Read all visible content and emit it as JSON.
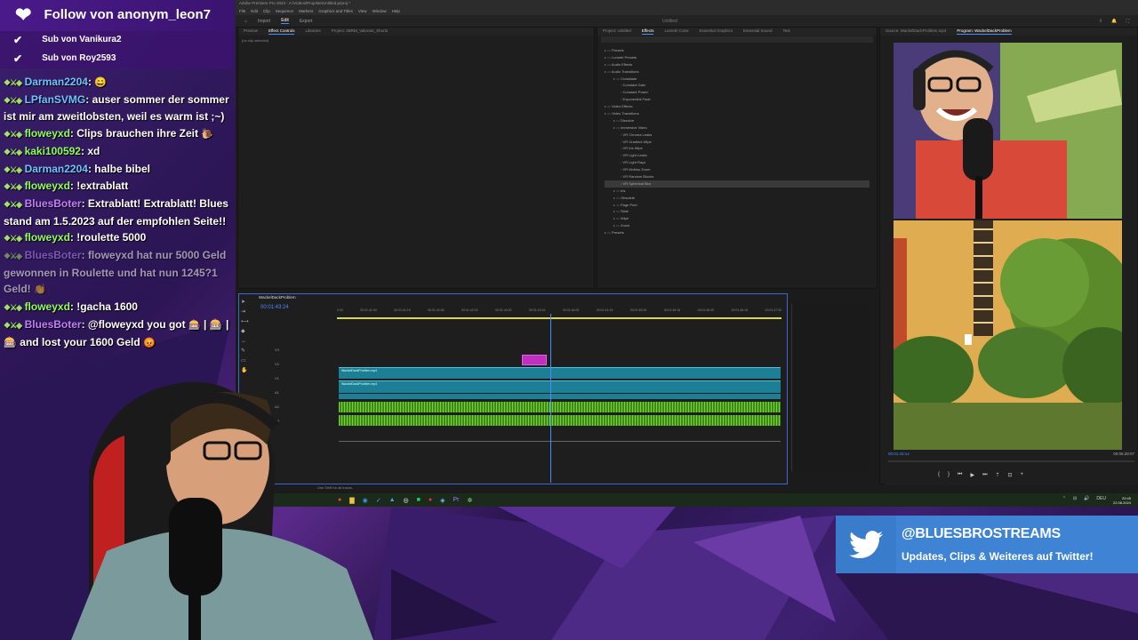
{
  "premiere": {
    "title": "Adobe Premiere Pro 2024 - A:\\Videos\\Projekte\\Untitled.prproj *",
    "menu": [
      "File",
      "Edit",
      "Clip",
      "Sequence",
      "Markers",
      "Graphics and Titles",
      "View",
      "Window",
      "Help"
    ],
    "workspaces": [
      "Import",
      "Edit",
      "Export"
    ],
    "active_workspace": "Edit",
    "project_name": "Untitled",
    "source_tabs": [
      "Preview",
      "Effect Controls",
      "Libraries",
      "Project: 2BRM_Valorant_Shorts"
    ],
    "no_clip": "(no clip selected)",
    "effects_tabs": [
      "Project: Untitled",
      "Effects",
      "Lumetri Color",
      "Essential Graphics",
      "Essential Sound",
      "Text"
    ],
    "effects_items": [
      {
        "label": "Presets",
        "type": "folder",
        "level": 0
      },
      {
        "label": "Lumetri Presets",
        "type": "folder",
        "level": 0
      },
      {
        "label": "Audio Effects",
        "type": "folder",
        "level": 0
      },
      {
        "label": "Audio Transitions",
        "type": "folder",
        "level": 0
      },
      {
        "label": "Crossfade",
        "type": "folder",
        "level": 1
      },
      {
        "label": "Constant Gain",
        "type": "item",
        "level": 2
      },
      {
        "label": "Constant Power",
        "type": "item",
        "level": 2
      },
      {
        "label": "Exponential Fade",
        "type": "item",
        "level": 2
      },
      {
        "label": "Video Effects",
        "type": "folder",
        "level": 0
      },
      {
        "label": "Video Transitions",
        "type": "folder",
        "level": 0
      },
      {
        "label": "Dissolve",
        "type": "folder",
        "level": 1
      },
      {
        "label": "Immersive Video",
        "type": "folder",
        "level": 1
      },
      {
        "label": "VR Chroma Leaks",
        "type": "item",
        "level": 2
      },
      {
        "label": "VR Gradient Wipe",
        "type": "item",
        "level": 2
      },
      {
        "label": "VR Iris Wipe",
        "type": "item",
        "level": 2
      },
      {
        "label": "VR Light Leaks",
        "type": "item",
        "level": 2
      },
      {
        "label": "VR Light Rays",
        "type": "item",
        "level": 2
      },
      {
        "label": "VR Mobius Zoom",
        "type": "item",
        "level": 2
      },
      {
        "label": "VR Random Blocks",
        "type": "item",
        "level": 2
      },
      {
        "label": "VR Spherical Blur",
        "type": "item",
        "level": 2,
        "selected": true
      },
      {
        "label": "Iris",
        "type": "folder",
        "level": 1
      },
      {
        "label": "Obsolete",
        "type": "folder",
        "level": 1
      },
      {
        "label": "Page Peel",
        "type": "folder",
        "level": 1
      },
      {
        "label": "Slide",
        "type": "folder",
        "level": 1
      },
      {
        "label": "Wipe",
        "type": "folder",
        "level": 1
      },
      {
        "label": "Zoom",
        "type": "folder",
        "level": 1
      },
      {
        "label": "Presets",
        "type": "folder",
        "level": 0
      }
    ],
    "program_tabs": [
      "Source: WackelDackProblem.mp4",
      "Program: WackelDackProblem"
    ],
    "program_timecode": "00:01:43:14",
    "program_duration": "00:05:28:07",
    "sequence_tab": "WackelDackProblem",
    "sequence_timecode": "00:01:43:24",
    "ruler_ticks": [
      "0:00",
      "00:01:41:00",
      "00:01:41:15",
      "00:01:42:00",
      "00:01:42:15",
      "00:01:43:00",
      "00:01:43:15",
      "00:01:44:00",
      "00:01:44:15",
      "00:01:45:00",
      "00:01:45:15",
      "00:01:46:00",
      "00:01:46:15",
      "00:01:47:00"
    ],
    "clip_v2": "WackelDackProblem.mp4",
    "clip_v1": "WackelDackProblem.mp4",
    "status_hint": "Use Shift for all tracks."
  },
  "taskbar": {
    "clock_time": "20:45",
    "clock_date": "22.08.2024",
    "lang": "DEU"
  },
  "chat": {
    "follow_text": "Follow von anonym_leon7",
    "subs": [
      "Sub von Vanikura2",
      "Sub von Roy2593"
    ],
    "messages": [
      {
        "user": "Darman2204",
        "color": "u-blue",
        "text": " ",
        "emote": "😄"
      },
      {
        "user": "LPfanSVMG",
        "color": "u-blue",
        "text": "auser sommer der sommer ist mir am zweitlobsten, weil es warm ist ;~)"
      },
      {
        "user": "floweyxd",
        "color": "u-green",
        "text": "Clips brauchen ihre Zeit",
        "emote": "🐌"
      },
      {
        "user": "kaki100592",
        "color": "u-green",
        "text": "xd"
      },
      {
        "user": "Darman2204",
        "color": "u-blue",
        "text": "halbe bibel"
      },
      {
        "user": "floweyxd",
        "color": "u-green",
        "text": "!extrablatt"
      },
      {
        "user": "BluesBoter",
        "color": "u-purple",
        "text": "Extrablatt! Extrablatt! Blues stand am 1.5.2023 auf der empfohlen Seite!!"
      },
      {
        "user": "floweyxd",
        "color": "u-green",
        "text": "!roulette 5000"
      },
      {
        "user": "BluesBoter",
        "color": "u-lav",
        "text": "floweyxd hat nur 5000 Geld gewonnen in Roulette und hat nun 1245?1 Geld!",
        "emote": "👏",
        "faded": true
      },
      {
        "user": "floweyxd",
        "color": "u-green",
        "text": "!gacha 1600"
      },
      {
        "user": "BluesBoter",
        "color": "u-purple",
        "text": "@floweyxd you got",
        "emote": "🎰",
        "after": "| 🎰 | 🎰 and lost your 1600 Geld",
        "emote2": "😡"
      }
    ]
  },
  "twitter": {
    "handle": "@BLUESBROSTREAMS",
    "subtitle": "Updates, Clips & Weiteres auf Twitter!"
  },
  "colors": {
    "accent_blue": "#4a8cff",
    "clip_teal": "#1c7f96",
    "audio_green": "#7ad13a",
    "twitter_blue": "#3f84d4",
    "chat_purple": "#4a1a8a"
  }
}
